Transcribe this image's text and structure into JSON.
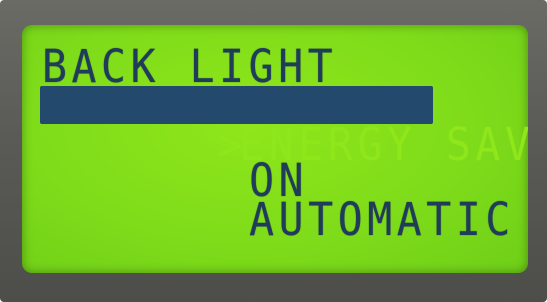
{
  "lcd": {
    "title": "BACK LIGHT",
    "cursor_glyph": ">",
    "options": [
      {
        "label": "ENERGY SAVE",
        "selected": true
      },
      {
        "label": "ON",
        "selected": false
      },
      {
        "label": "AUTOMATIC",
        "selected": false
      }
    ]
  },
  "colors": {
    "screen_backlight": "#8fe61a",
    "pixel_dark": "#1f3d5a",
    "selection_bar": "#23496c",
    "bezel": "#5a5a56"
  }
}
